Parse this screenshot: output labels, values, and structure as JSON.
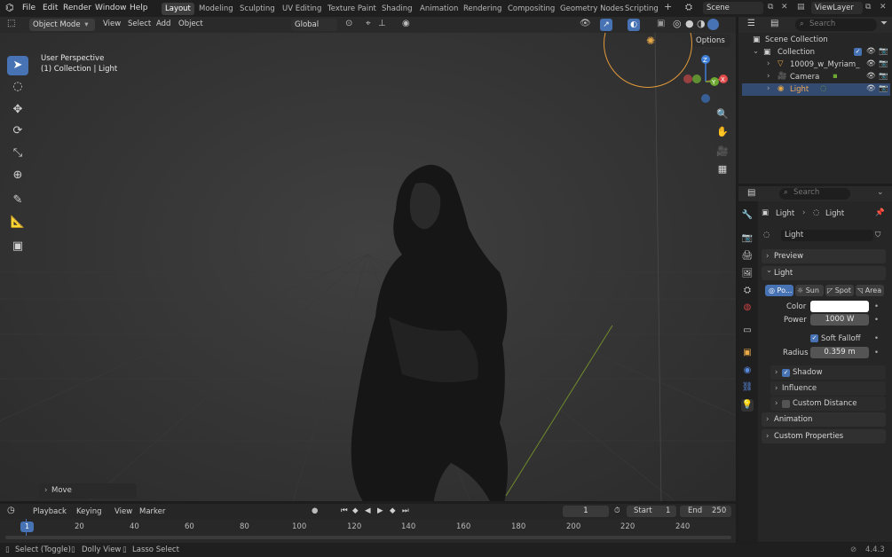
{
  "topbar": {
    "menus": [
      "File",
      "Edit",
      "Render",
      "Window",
      "Help"
    ],
    "workspaces": [
      "Layout",
      "Modeling",
      "Sculpting",
      "UV Editing",
      "Texture Paint",
      "Shading",
      "Animation",
      "Rendering",
      "Compositing",
      "Geometry Nodes",
      "Scripting"
    ],
    "active_workspace": "Layout",
    "add_tab": "+",
    "scene": "Scene",
    "view_layer": "ViewLayer"
  },
  "viewport_header": {
    "mode": "Object Mode",
    "menus": [
      "View",
      "Select",
      "Add",
      "Object"
    ],
    "orientation": "Global",
    "options": "Options"
  },
  "viewport": {
    "perspective": "User Perspective",
    "collection_info": "(1) Collection | Light",
    "gizmo_axes": {
      "x": "X",
      "y": "Y",
      "z": "Z"
    },
    "last_op": "Move"
  },
  "outliner": {
    "search_placeholder": "Search",
    "items": [
      {
        "label": "Scene Collection"
      },
      {
        "label": "Collection"
      },
      {
        "label": "10009_w_Myriam_"
      },
      {
        "label": "Camera"
      },
      {
        "label": "Light"
      }
    ]
  },
  "properties": {
    "search_placeholder": "Search",
    "breadcrumb": [
      "Light",
      "Light"
    ],
    "datablock": "Light",
    "panels": {
      "preview": "Preview",
      "light": "Light",
      "shadow": "Shadow",
      "influence": "Influence",
      "custom_distance": "Custom Distance",
      "animation": "Animation",
      "custom_properties": "Custom Properties"
    },
    "light_types": [
      "Po...",
      "Sun",
      "Spot",
      "Area"
    ],
    "fields": {
      "color_label": "Color",
      "power_label": "Power",
      "power_value": "1000 W",
      "soft_falloff": "Soft Falloff",
      "radius_label": "Radius",
      "radius_value": "0.359 m"
    }
  },
  "timeline": {
    "menus": [
      "Playback",
      "Keying",
      "View",
      "Marker"
    ],
    "current_frame": "1",
    "start_label": "Start",
    "start_value": "1",
    "end_label": "End",
    "end_value": "250",
    "ticks": [
      "1",
      "20",
      "40",
      "60",
      "80",
      "100",
      "120",
      "140",
      "160",
      "180",
      "200",
      "220",
      "240"
    ]
  },
  "statusbar": {
    "hints": [
      "Select (Toggle)",
      "Dolly View",
      "Lasso Select"
    ],
    "version": "4.4.3"
  },
  "colors": {
    "accent": "#4772b3",
    "x_axis": "#e04b4b",
    "y_axis": "#6da832",
    "z_axis": "#3d7fd9"
  }
}
